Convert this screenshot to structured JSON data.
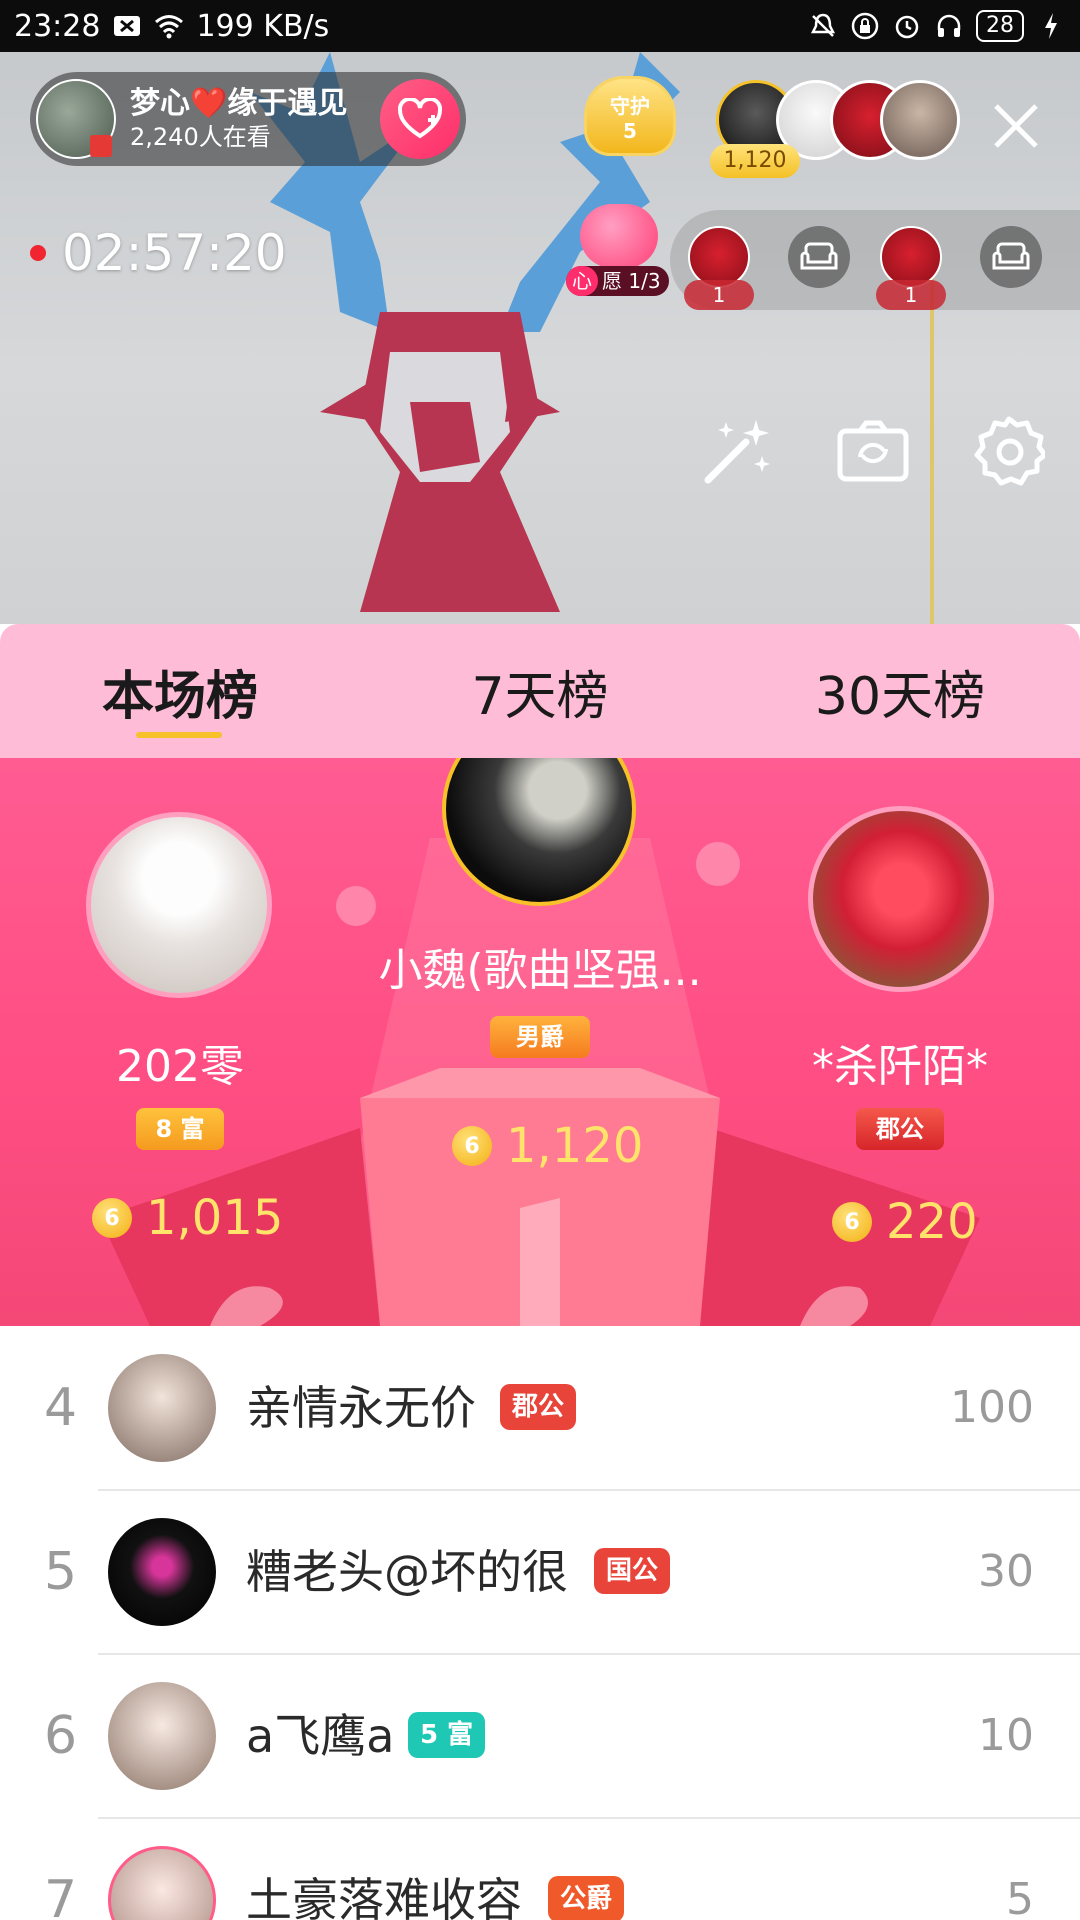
{
  "status_bar": {
    "time": "23:28",
    "network_speed": "199 KB/s",
    "battery": "28",
    "icons": [
      "notification-icon",
      "wifi-icon",
      "mute-icon",
      "lock-icon",
      "alarm-icon",
      "headphones-icon",
      "battery-icon",
      "charging-icon"
    ]
  },
  "live": {
    "host_name": "梦心❤️缘于遇见",
    "viewers": "2,240人在看",
    "guard_label": "守护",
    "guard_count": "5",
    "top_viewer_score": "1,120",
    "timer": "02:57:20",
    "wish_tag": "心",
    "wish_label": "愿 1/3",
    "seats": [
      {
        "type": "rose",
        "count": "1"
      },
      {
        "type": "empty"
      },
      {
        "type": "rose",
        "count": "1"
      },
      {
        "type": "empty"
      }
    ],
    "tools": [
      "beauty-wand-icon",
      "flip-camera-icon",
      "settings-icon"
    ]
  },
  "tabs": [
    {
      "label": "本场榜",
      "active": true
    },
    {
      "label": "7天榜",
      "active": false
    },
    {
      "label": "30天榜",
      "active": false
    }
  ],
  "podium": {
    "first": {
      "name": "小魏(歌曲坚强...",
      "badge": "男爵",
      "coins": "1,120"
    },
    "second": {
      "name": "202零",
      "badge": "8 富",
      "coins": "1,015"
    },
    "third": {
      "name": "*杀阡陌*",
      "badge": "郡公",
      "coins": "220"
    },
    "coin_symbol": "6"
  },
  "ranking": [
    {
      "rank": "4",
      "name": "亲情永无价",
      "title": "郡公",
      "title_color": "#e8443a",
      "score": "100"
    },
    {
      "rank": "5",
      "name": "糟老头@坏的很",
      "title": "国公",
      "title_color": "#e8443a",
      "score": "30"
    },
    {
      "rank": "6",
      "name": "a飞鹰a",
      "title": "5 富",
      "title_color": "#1fc7b5",
      "score": "10"
    },
    {
      "rank": "7",
      "name": "土豪落难收容",
      "title": "公爵",
      "title_color": "#f05a2a",
      "score": "5"
    }
  ]
}
